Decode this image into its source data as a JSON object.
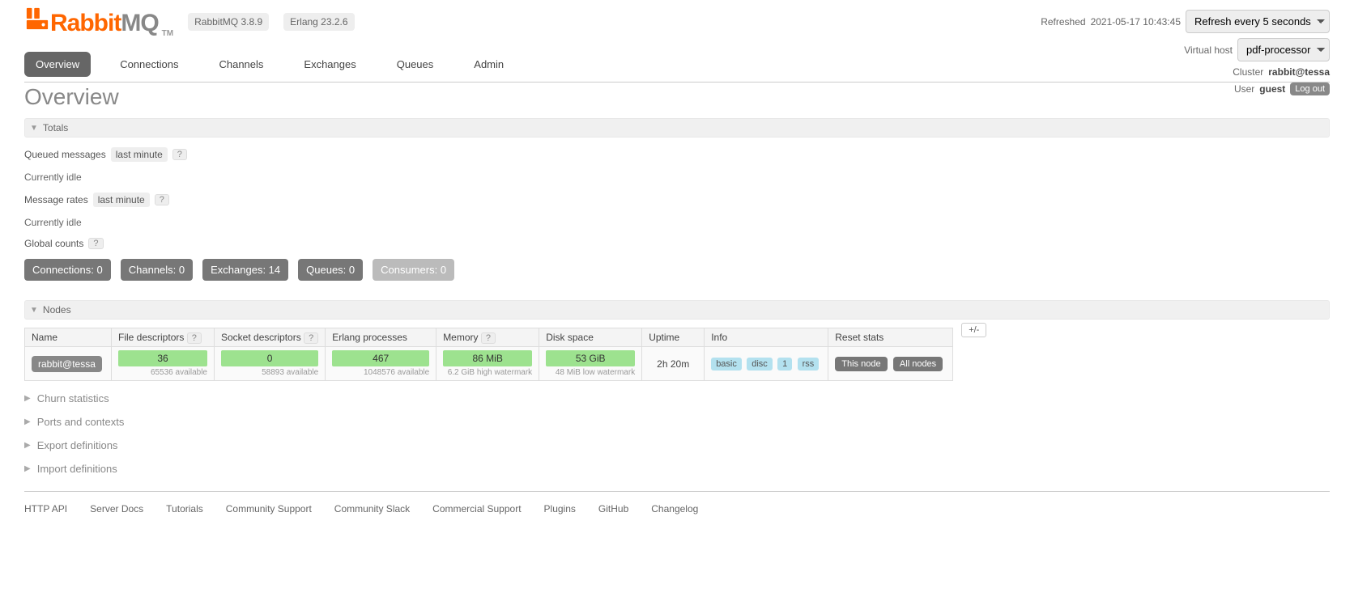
{
  "header": {
    "product": "RabbitMQ",
    "tm": "TM",
    "version": "RabbitMQ 3.8.9",
    "erlang": "Erlang 23.2.6",
    "refreshed_label": "Refreshed",
    "refreshed_time": "2021-05-17 10:43:45",
    "refresh_select": "Refresh every 5 seconds",
    "vhost_label": "Virtual host",
    "vhost_select": "pdf-processor",
    "cluster_label": "Cluster",
    "cluster_value": "rabbit@tessa",
    "user_label": "User",
    "user_value": "guest",
    "logout": "Log out"
  },
  "tabs": {
    "overview": "Overview",
    "connections": "Connections",
    "channels": "Channels",
    "exchanges": "Exchanges",
    "queues": "Queues",
    "admin": "Admin"
  },
  "page_title": "Overview",
  "sections": {
    "totals": "Totals",
    "nodes": "Nodes",
    "churn": "Churn statistics",
    "ports": "Ports and contexts",
    "export": "Export definitions",
    "import": "Import definitions"
  },
  "totals": {
    "queued_label": "Queued messages",
    "last_minute": "last minute",
    "help": "?",
    "idle": "Currently idle",
    "rates_label": "Message rates",
    "global_label": "Global counts",
    "counts": {
      "connections": "Connections: 0",
      "channels": "Channels: 0",
      "exchanges": "Exchanges: 14",
      "queues": "Queues: 0",
      "consumers": "Consumers: 0"
    }
  },
  "node_headers": {
    "name": "Name",
    "fd": "File descriptors",
    "sd": "Socket descriptors",
    "ep": "Erlang processes",
    "mem": "Memory",
    "disk": "Disk space",
    "uptime": "Uptime",
    "info": "Info",
    "reset": "Reset stats",
    "plusminus": "+/-"
  },
  "node": {
    "name": "rabbit@tessa",
    "fd_val": "36",
    "fd_avail": "65536 available",
    "sd_val": "0",
    "sd_avail": "58893 available",
    "ep_val": "467",
    "ep_avail": "1048576 available",
    "mem_val": "86 MiB",
    "mem_note": "6.2 GiB high watermark",
    "disk_val": "53 GiB",
    "disk_note": "48 MiB low watermark",
    "uptime": "2h 20m",
    "info_basic": "basic",
    "info_disc": "disc",
    "info_1": "1",
    "info_rss": "rss",
    "reset_this": "This node",
    "reset_all": "All nodes"
  },
  "footer": {
    "api": "HTTP API",
    "docs": "Server Docs",
    "tut": "Tutorials",
    "csupport": "Community Support",
    "cslack": "Community Slack",
    "comm": "Commercial Support",
    "plugins": "Plugins",
    "gh": "GitHub",
    "cl": "Changelog"
  }
}
